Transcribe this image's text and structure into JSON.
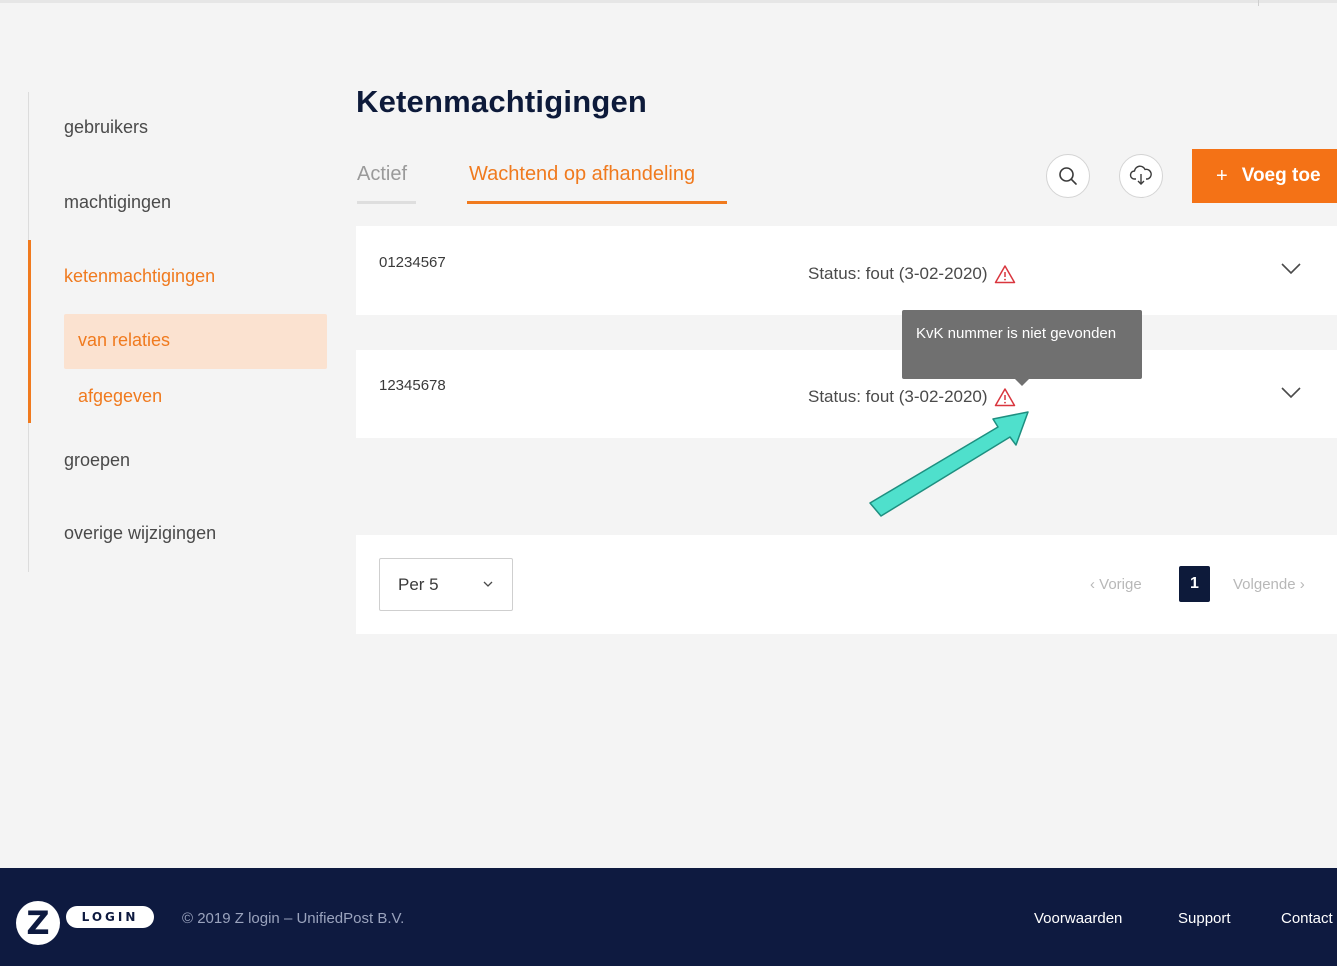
{
  "sidebar": {
    "items": [
      {
        "label": "gebruikers"
      },
      {
        "label": "machtigingen"
      },
      {
        "label": "ketenmachtigingen"
      },
      {
        "label": "groepen"
      },
      {
        "label": "overige wijzigingen"
      }
    ],
    "subitems": [
      {
        "label": "van relaties"
      },
      {
        "label": "afgegeven"
      }
    ]
  },
  "main": {
    "title": "Ketenmachtigingen",
    "tabs": [
      {
        "label": "Actief"
      },
      {
        "label": "Wachtend op afhandeling"
      }
    ],
    "add_button": {
      "plus": "+",
      "label": "Voeg toe"
    },
    "rows": [
      {
        "id": "01234567",
        "status": "Status: fout (3-02-2020)"
      },
      {
        "id": "12345678",
        "status": "Status: fout (3-02-2020)"
      }
    ],
    "tooltip": "KvK nummer is niet gevonden",
    "pagination": {
      "per_page": "Per 5",
      "prev": "‹ Vorige",
      "current": "1",
      "next": "Volgende ›"
    }
  },
  "footer": {
    "logo_letter": "Z",
    "logo_text": "LOGIN",
    "copyright": "© 2019 Z login – UnifiedPost B.V.",
    "links": [
      "Voorwaarden",
      "Support",
      "Contact"
    ]
  },
  "colors": {
    "accent": "#f47216",
    "navy": "#0e1a40",
    "warning": "#d9363e",
    "annotation_arrow": "#4fe0cc"
  }
}
